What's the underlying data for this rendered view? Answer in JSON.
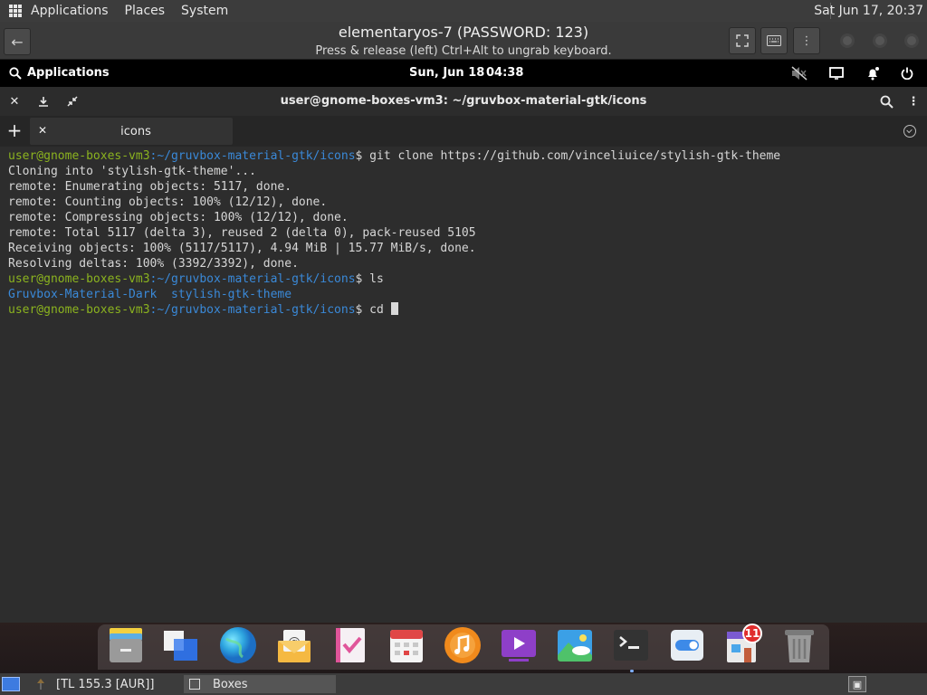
{
  "host_panel": {
    "menus": [
      "Applications",
      "Places",
      "System"
    ],
    "clock": "Sat Jun 17, 20:37"
  },
  "boxes": {
    "title": "elementaryos-7 (PASSWORD: 123)",
    "subtitle": "Press & release (left) Ctrl+Alt to ungrab keyboard."
  },
  "guest_panel": {
    "applications": "Applications",
    "date": "Sun, Jun 18",
    "time": "04:38"
  },
  "terminal": {
    "title": "user@gnome-boxes-vm3: ~/gruvbox-material-gtk/icons",
    "tab_label": "icons",
    "prompt_user": "user@gnome-boxes-vm3",
    "prompt_path": ":~/gruvbox-material-gtk/icons",
    "prompt_symbol": "$",
    "cmd1": " git clone https://github.com/vinceliuice/stylish-gtk-theme",
    "output": [
      "Cloning into 'stylish-gtk-theme'...",
      "remote: Enumerating objects: 5117, done.",
      "remote: Counting objects: 100% (12/12), done.",
      "remote: Compressing objects: 100% (12/12), done.",
      "remote: Total 5117 (delta 3), reused 2 (delta 0), pack-reused 5105",
      "Receiving objects: 100% (5117/5117), 4.94 MiB | 15.77 MiB/s, done.",
      "Resolving deltas: 100% (3392/3392), done."
    ],
    "cmd2": " ls",
    "ls_items": [
      "Gruvbox-Material-Dark",
      "stylish-gtk-theme"
    ],
    "cmd3": " cd "
  },
  "dock": {
    "badge": "11"
  },
  "host_bottom": {
    "task1": "[TL 155.3 [AUR]]",
    "task2": "Boxes"
  }
}
